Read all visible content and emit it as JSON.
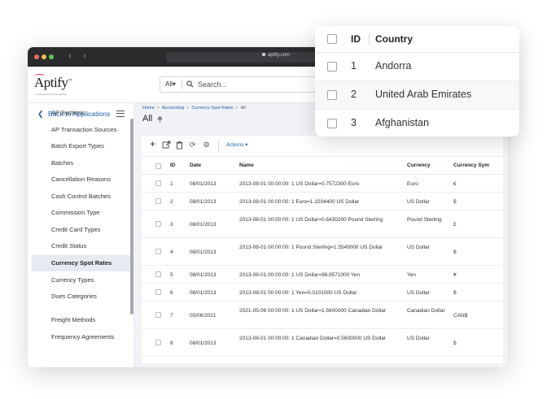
{
  "browser": {
    "url": "aptify.com",
    "back_glyph": "‹",
    "fwd_glyph": "›"
  },
  "brand": {
    "logo": "Aptify",
    "logo_mark": "™",
    "tagline": "a community brands solution",
    "accent_color": "#1a5ea8"
  },
  "search": {
    "scope": "All▾",
    "placeholder": "Search..."
  },
  "sidebar": {
    "back_label": "Back to Applications",
    "items": [
      {
        "label": "AP Systems"
      },
      {
        "label": "AP Transaction Sources"
      },
      {
        "label": "Batch Export Types"
      },
      {
        "label": "Batches"
      },
      {
        "label": "Cancellation Reasons"
      },
      {
        "label": "Cash Control Batches"
      },
      {
        "label": "Commission Type"
      },
      {
        "label": "Credit Card Types"
      },
      {
        "label": "Credit Status"
      },
      {
        "label": "Currency Spot Rates",
        "active": true
      },
      {
        "label": "Currency Types"
      },
      {
        "label": "Dues Categories"
      },
      {
        "label": "Freight Methods"
      },
      {
        "label": "Frequency Agreements"
      }
    ]
  },
  "breadcrumb": {
    "home": "Home",
    "accounting": "Accounting",
    "spot_rates": "Currency Spot Rates",
    "current": "All",
    "sep": ">"
  },
  "page": {
    "title": "All"
  },
  "toolbar": {
    "actions_label": "Actions ▾"
  },
  "grid": {
    "columns": [
      "ID",
      "Date",
      "Name",
      "Currency",
      "Currency Sym"
    ],
    "rows": [
      {
        "id": "1",
        "date": "08/01/2013",
        "name": "2013-08-01 00:00:00: 1 US Dollar=0.7572300 Euro",
        "currency": "Euro",
        "symbol": "€"
      },
      {
        "id": "2",
        "date": "08/01/2013",
        "name": "2013-08-01 00:00:00: 1 Euro=1.3204400 US Dollar",
        "currency": "US Dollar",
        "symbol": "$"
      },
      {
        "id": "3",
        "date": "08/01/2013",
        "name": "2013-08-01 00:00:00: 1 US Dollar=0.6430200 Pound Sterling",
        "currency": "Pound Sterling",
        "symbol": "£"
      },
      {
        "id": "4",
        "date": "08/01/2013",
        "name": "2013-08-01 00:00:00: 1 Pound Sterling=1.5549000 US Dollar",
        "currency": "US Dollar",
        "symbol": "$"
      },
      {
        "id": "5",
        "date": "08/01/2013",
        "name": "2013-08-01 00:00:00: 1 US Dollar=98.9571000 Yen",
        "currency": "Yen",
        "symbol": "¥"
      },
      {
        "id": "6",
        "date": "08/01/2013",
        "name": "2013-08-01 00:00:00: 1 Yen=0.0101000 US Dollar",
        "currency": "US Dollar",
        "symbol": "$"
      },
      {
        "id": "7",
        "date": "05/06/2021",
        "name": "2021-05-06 00:00:00: 1 US Dollar=1.5600000 Canadian Dollar",
        "currency": "Canadian Dollar",
        "symbol": "CAN$"
      },
      {
        "id": "8",
        "date": "08/01/2013",
        "name": "2013-08-01 00:00:00: 1 Canadian Dollar=0.5600000 US Dollar",
        "currency": "US Dollar",
        "symbol": "$"
      }
    ]
  },
  "popup": {
    "columns": [
      "ID",
      "Country"
    ],
    "rows": [
      {
        "id": "1",
        "country": "Andorra"
      },
      {
        "id": "2",
        "country": "United Arab Emirates"
      },
      {
        "id": "3",
        "country": "Afghanistan"
      }
    ]
  }
}
